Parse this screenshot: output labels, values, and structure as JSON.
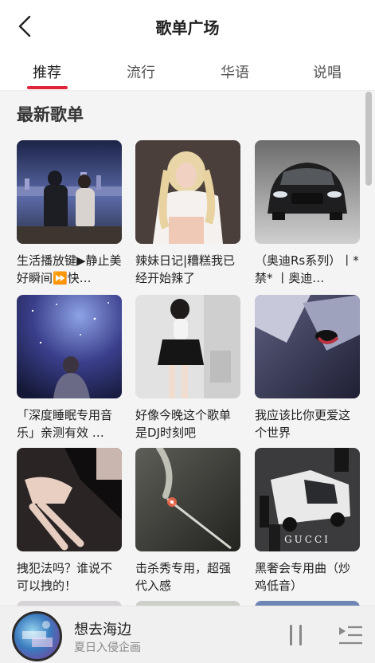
{
  "header": {
    "title": "歌单广场"
  },
  "tabs": [
    {
      "label": "推荐",
      "active": true
    },
    {
      "label": "流行",
      "active": false
    },
    {
      "label": "华语",
      "active": false
    },
    {
      "label": "说唱",
      "active": false
    }
  ],
  "section": {
    "title": "最新歌单"
  },
  "playlists": [
    {
      "title": "生活播放键▶静止美好瞬间⏩快…"
    },
    {
      "title": "辣妹日记|糟糕我已经开始辣了"
    },
    {
      "title": "（奥迪Rs系列）丨*禁* 丨奥迪…"
    },
    {
      "title": "「深度睡眠专用音乐」亲测有效 …"
    },
    {
      "title": "好像今晚这个歌单是DJ时刻吧"
    },
    {
      "title": "我应该比你更爱这个世界"
    },
    {
      "title": "拽犯法吗？谁说不可以拽的！"
    },
    {
      "title": "击杀秀专用，超强代入感"
    },
    {
      "title": "黑奢会专用曲（炒鸡低音）"
    }
  ],
  "covers": {
    "gucci_text": "GUCCI"
  },
  "player": {
    "song": "想去海边",
    "artist": "夏日入侵企画"
  },
  "colors": {
    "accent": "#e0263b"
  }
}
